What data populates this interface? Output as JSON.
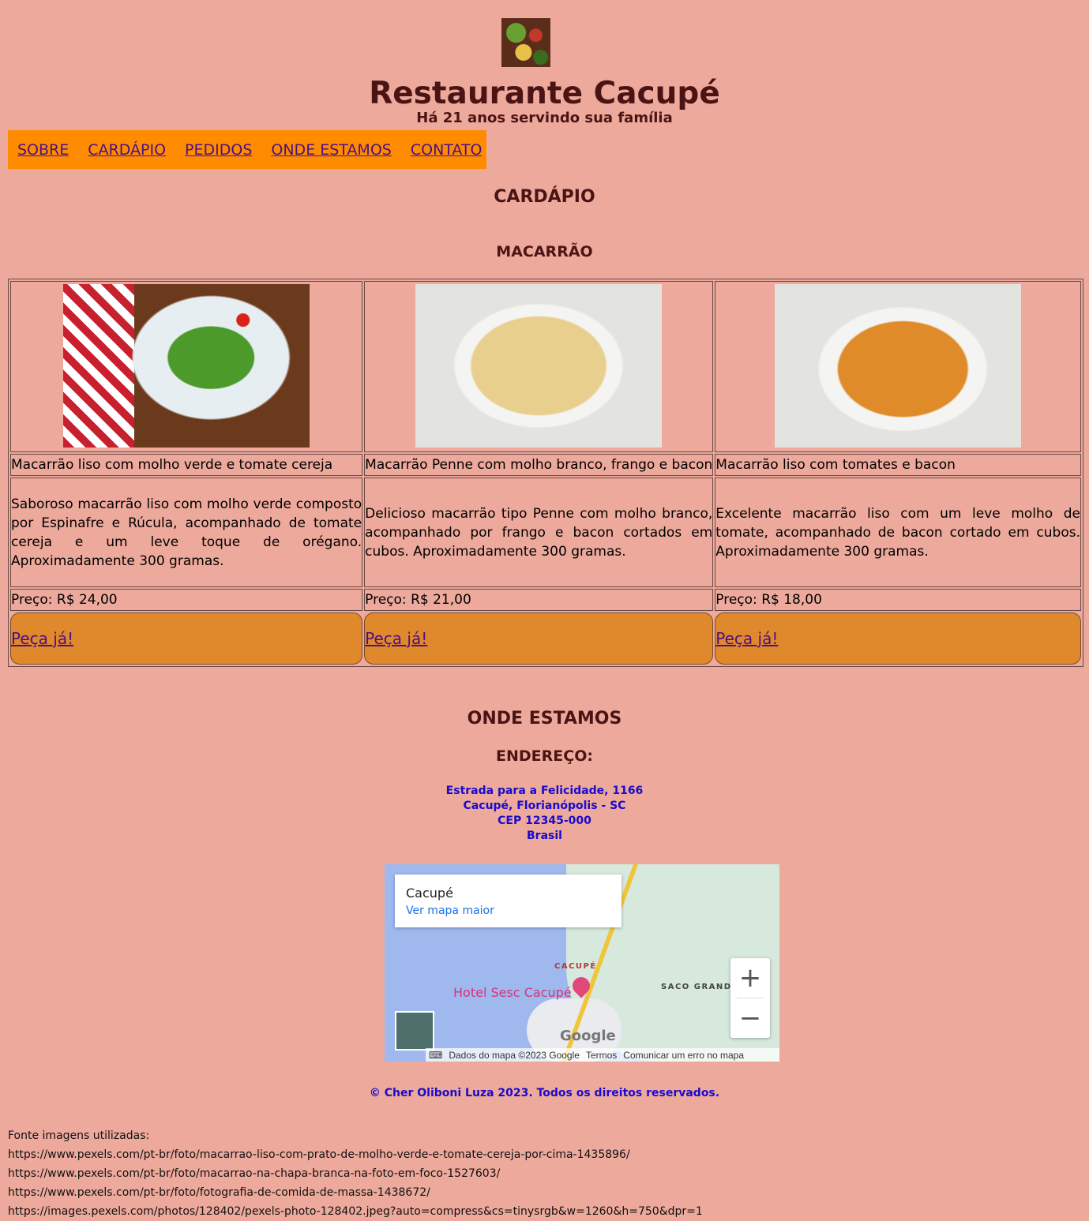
{
  "header": {
    "logo_icon": "food-collage-logo",
    "title": "Restaurante Cacupé",
    "subtitle": "Há 21 anos servindo sua família"
  },
  "nav": {
    "items": [
      "SOBRE",
      "CARDÁPIO",
      "PEDIDOS",
      "ONDE ESTAMOS",
      "CONTATO"
    ]
  },
  "menu": {
    "heading": "CARDÁPIO",
    "category": "MACARRÃO",
    "order_label": "Peça já!",
    "dishes": [
      {
        "image": "green-pasta-photo",
        "name": "Macarrão liso com molho verde e tomate cereja",
        "description": "Saboroso macarrão liso com molho verde composto por Espinafre e Rúcula, acompanhado de tomate cereja e um leve toque de orégano. Aproximadamente 300 gramas.",
        "price": "Preço: R$ 24,00"
      },
      {
        "image": "penne-white-sauce-photo",
        "name": "Macarrão Penne com molho branco, frango e bacon",
        "description": "Delicioso macarrão tipo Penne com molho branco, acompanhado por frango e bacon cortados em cubos. Aproximadamente 300 gramas.",
        "price": "Preço: R$ 21,00"
      },
      {
        "image": "tomato-bacon-pasta-photo",
        "name": "Macarrão liso com tomates e bacon",
        "description": "Excelente macarrão liso com um leve molho de tomate, acompanhado de bacon cortado em cubos. Aproximadamente 300 gramas.",
        "price": "Preço: R$ 18,00"
      }
    ]
  },
  "location": {
    "heading": "ONDE ESTAMOS",
    "address_heading": "ENDEREÇO:",
    "address_lines": [
      "Estrada para a Felicidade, 1166",
      "Cacupé, Florianópolis - SC",
      "CEP 12345-000",
      "Brasil"
    ]
  },
  "map": {
    "place_name": "Cacupé",
    "larger_map_link": "Ver mapa maior",
    "label_cacupe": "CACUPÉ",
    "label_saco_grande": "SACO GRANDE",
    "hotel": "Hotel Sesc Cacupé",
    "google": "Google",
    "zoom_in": "+",
    "zoom_out": "−",
    "footer_data": "Dados do mapa ©2023 Google",
    "footer_terms": "Termos",
    "footer_report": "Comunicar um erro no mapa"
  },
  "footer": {
    "copyright": "© Cher Oliboni Luza 2023. Todos os direitos reservados.",
    "sources_title": "Fonte imagens utilizadas:",
    "sources": [
      "https://www.pexels.com/pt-br/foto/macarrao-liso-com-prato-de-molho-verde-e-tomate-cereja-por-cima-1435896/",
      "https://www.pexels.com/pt-br/foto/macarrao-na-chapa-branca-na-foto-em-foco-1527603/",
      "https://www.pexels.com/pt-br/foto/fotografia-de-comida-de-massa-1438672/",
      "https://images.pexels.com/photos/128402/pexels-photo-128402.jpeg?auto=compress&cs=tinysrgb&w=1260&h=750&dpr=1"
    ]
  },
  "colors": {
    "background": "#eda99b",
    "nav_bg": "#ff8c00",
    "order_button_bg": "#e0892c",
    "heading": "#4b1414",
    "link": "#4b1082",
    "address": "#1a0acc"
  }
}
